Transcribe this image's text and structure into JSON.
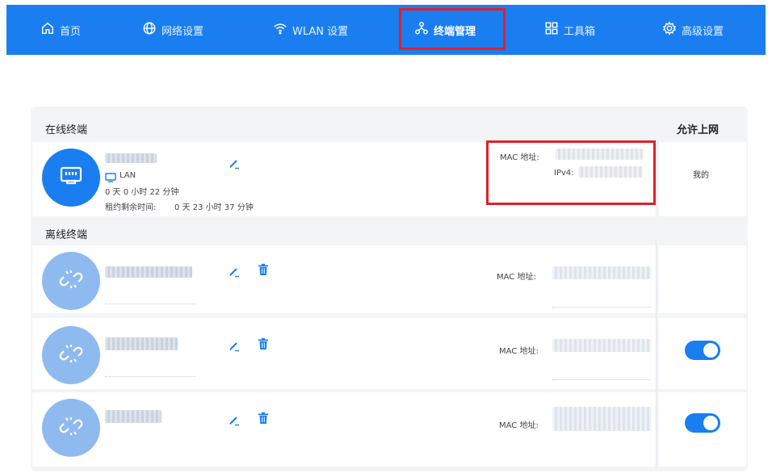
{
  "nav": {
    "items": [
      {
        "label": "首页",
        "icon": "home-icon"
      },
      {
        "label": "网络设置",
        "icon": "globe-icon"
      },
      {
        "label": "WLAN 设置",
        "icon": "wifi-icon"
      },
      {
        "label": "终端管理",
        "icon": "network-nodes-icon",
        "active": true
      },
      {
        "label": "工具箱",
        "icon": "toolbox-icon"
      },
      {
        "label": "高级设置",
        "icon": "gear-icon"
      }
    ]
  },
  "online": {
    "section_title": "在线终端",
    "column_allow": "允许上网",
    "device": {
      "connection": "LAN",
      "online_time": "0 天 0 小时 22 分钟",
      "lease_label": "租约剩余时间:",
      "lease_value": "0 天 23 小时 37 分钟",
      "mac_label": "MAC 地址:",
      "ipv4_label": "IPv4:",
      "allow_text": "我的"
    }
  },
  "offline": {
    "section_title": "离线终端",
    "devices": [
      {
        "mac_label": "MAC 地址:",
        "allow_toggle": false
      },
      {
        "mac_label": "MAC 地址:",
        "allow_toggle": true
      },
      {
        "mac_label": "MAC 地址:",
        "allow_toggle": true
      }
    ]
  },
  "colors": {
    "brand": "#1a7ef0",
    "highlight": "#e0202a"
  }
}
